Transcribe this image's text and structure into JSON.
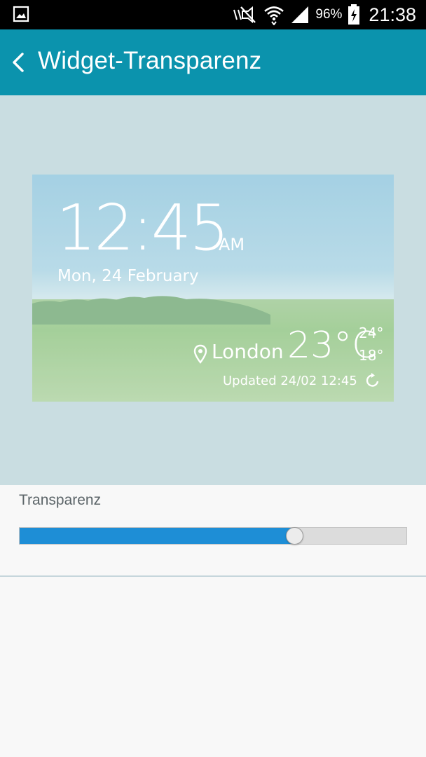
{
  "status_bar": {
    "left_icon": "gallery-icon",
    "icons": [
      "mute-icon",
      "wifi-icon",
      "signal-icon",
      "battery-charging-icon"
    ],
    "battery_percent": "96%",
    "time": "21:38"
  },
  "app_bar": {
    "back_icon": "back-arrow-icon",
    "title": "Widget-Transparenz",
    "color": "#0b93ad"
  },
  "widget_preview": {
    "clock_time": "12:45",
    "ampm": "AM",
    "date": "Mon, 24 February",
    "location_icon": "location-pin-icon",
    "city": "London",
    "temperature": "23°C",
    "high": "24°",
    "low": "18°",
    "updated": "Updated 24/02 12:45",
    "refresh_icon": "refresh-icon"
  },
  "transparency": {
    "label": "Transparenz",
    "value_fraction": 0.71,
    "fill_color": "#1e8ed6"
  }
}
